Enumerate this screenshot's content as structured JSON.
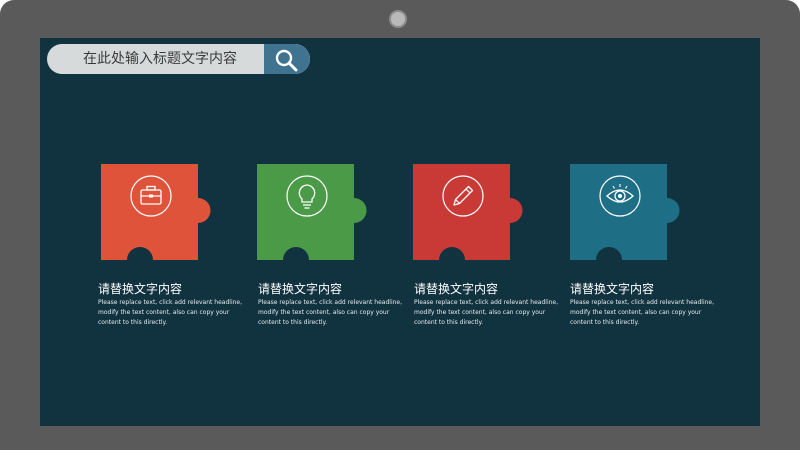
{
  "search": {
    "placeholder_text": "在此处输入标题文字内容",
    "button_icon": "search-icon"
  },
  "cards": [
    {
      "color": "#e0533b",
      "icon": "briefcase-icon",
      "title": "请替换文字内容",
      "body": "Please replace text, click add relevant headline, modify the text content, also can copy your content to this directly."
    },
    {
      "color": "#4a9a47",
      "icon": "lightbulb-icon",
      "title": "请替换文字内容",
      "body": "Please replace text, click add relevant headline, modify the text content, also can copy your content to this directly."
    },
    {
      "color": "#c93a36",
      "icon": "pencil-icon",
      "title": "请替换文字内容",
      "body": "Please replace text, click add relevant headline, modify the text content, also can copy your content to this directly."
    },
    {
      "color": "#1e6f86",
      "icon": "eye-icon",
      "title": "请替换文字内容",
      "body": "Please replace text, click add relevant headline, modify the text content, also can copy your content to this directly."
    }
  ]
}
